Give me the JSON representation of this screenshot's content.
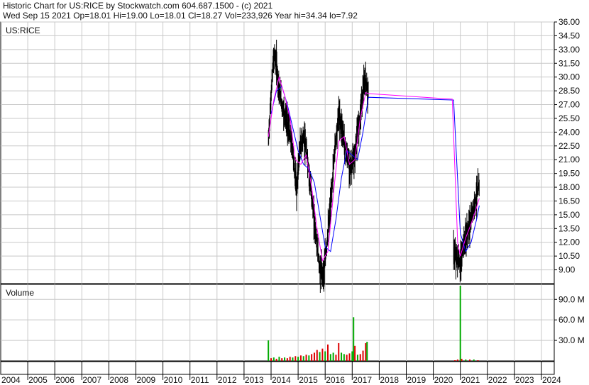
{
  "header": {
    "line1": "Historic Chart for US:RICE by Stockwatch.com 604.687.1500 - (c) 2021",
    "line2": "Wed Sep 15 2021   Op=18.01   Hi=19.00   Lo=18.01   Cl=18.27   Vol=233,926   Year hi=34.34   lo=7.92"
  },
  "price_panel": {
    "label": "US:RICE"
  },
  "volume_panel": {
    "label": "Volume"
  },
  "chart_data": {
    "type": "line",
    "ticker": "US:RICE",
    "x_labels": [
      "2004",
      "2005",
      "2006",
      "2007",
      "2008",
      "2009",
      "2010",
      "2011",
      "2012",
      "2013",
      "2014",
      "2015",
      "2016",
      "2017",
      "2018",
      "2019",
      "2020",
      "2021",
      "2022",
      "2023",
      "2024"
    ],
    "price_axis": {
      "ylim": [
        7.5,
        36.0
      ],
      "tick_labels": [
        "36.00",
        "34.50",
        "33.00",
        "31.50",
        "30.00",
        "28.50",
        "27.00",
        "25.50",
        "24.00",
        "22.50",
        "21.00",
        "19.50",
        "18.00",
        "16.50",
        "15.00",
        "13.50",
        "12.00",
        "10.50",
        "9.00"
      ]
    },
    "volume_axis": {
      "ylim": [
        0,
        110
      ],
      "tick_labels": [
        "90.0 M",
        "60.0 M",
        "30.0 M"
      ]
    },
    "price_series": {
      "x": [
        2013.9,
        2014.0,
        2014.1,
        2014.2,
        2014.3,
        2014.4,
        2014.6,
        2014.8,
        2014.95,
        2015.05,
        2015.2,
        2015.35,
        2015.5,
        2015.65,
        2015.8,
        2015.95,
        2016.05,
        2016.2,
        2016.35,
        2016.5,
        2016.65,
        2016.8,
        2016.95,
        2017.1,
        2017.25,
        2017.4,
        2017.5,
        2017.6,
        2020.75,
        2020.9,
        2021.0,
        2021.1,
        2021.25,
        2021.4,
        2021.55,
        2021.7
      ],
      "y": [
        23.0,
        28.0,
        32.5,
        31.5,
        28.5,
        27.0,
        25.0,
        22.0,
        17.5,
        22.0,
        23.5,
        21.0,
        17.0,
        13.0,
        9.0,
        8.5,
        11.5,
        16.0,
        22.0,
        26.0,
        24.0,
        21.5,
        20.0,
        21.5,
        25.0,
        28.5,
        29.5,
        28.0,
        11.0,
        10.0,
        9.5,
        11.5,
        13.0,
        14.5,
        16.5,
        18.27
      ]
    },
    "moving_average_short": {
      "color": "#ff00ff",
      "x": [
        2013.9,
        2014.1,
        2014.3,
        2014.5,
        2014.7,
        2014.9,
        2015.1,
        2015.3,
        2015.5,
        2015.7,
        2015.9,
        2016.1,
        2016.3,
        2016.5,
        2016.7,
        2016.9,
        2017.1,
        2017.3,
        2017.5,
        2017.6,
        2020.7,
        2020.9,
        2021.0,
        2021.2,
        2021.4,
        2021.6,
        2021.7
      ],
      "y": [
        23.5,
        27.5,
        30.0,
        28.0,
        25.5,
        21.0,
        20.5,
        21.5,
        18.0,
        13.5,
        10.0,
        11.0,
        17.0,
        23.0,
        23.5,
        20.5,
        21.0,
        25.5,
        28.3,
        28.2,
        27.6,
        12.0,
        10.5,
        12.5,
        14.0,
        15.8,
        16.8
      ]
    },
    "moving_average_long": {
      "color": "#0000ff",
      "x": [
        2014.0,
        2014.2,
        2014.4,
        2014.6,
        2014.8,
        2015.0,
        2015.2,
        2015.4,
        2015.6,
        2015.8,
        2016.0,
        2016.2,
        2016.4,
        2016.6,
        2016.8,
        2017.0,
        2017.2,
        2017.4,
        2017.6,
        2020.75,
        2021.0,
        2021.2,
        2021.4,
        2021.6,
        2021.7
      ],
      "y": [
        26.0,
        28.5,
        29.0,
        27.0,
        24.5,
        22.0,
        20.5,
        20.0,
        18.5,
        15.0,
        11.5,
        11.0,
        14.5,
        19.0,
        22.0,
        21.5,
        21.0,
        24.0,
        27.8,
        27.5,
        13.0,
        11.0,
        12.0,
        14.5,
        16.0
      ]
    },
    "volume_series": {
      "up_color": "#00aa00",
      "down_color": "#dd0000",
      "bars": [
        {
          "x": 2013.9,
          "v": 30,
          "c": "up"
        },
        {
          "x": 2014.0,
          "v": 4,
          "c": "down"
        },
        {
          "x": 2014.1,
          "v": 5,
          "c": "up"
        },
        {
          "x": 2014.2,
          "v": 3,
          "c": "down"
        },
        {
          "x": 2014.3,
          "v": 6,
          "c": "up"
        },
        {
          "x": 2014.4,
          "v": 4,
          "c": "down"
        },
        {
          "x": 2014.5,
          "v": 5,
          "c": "up"
        },
        {
          "x": 2014.6,
          "v": 4,
          "c": "down"
        },
        {
          "x": 2014.7,
          "v": 6,
          "c": "down"
        },
        {
          "x": 2014.8,
          "v": 5,
          "c": "up"
        },
        {
          "x": 2014.9,
          "v": 7,
          "c": "down"
        },
        {
          "x": 2015.0,
          "v": 6,
          "c": "up"
        },
        {
          "x": 2015.1,
          "v": 8,
          "c": "down"
        },
        {
          "x": 2015.2,
          "v": 7,
          "c": "up"
        },
        {
          "x": 2015.3,
          "v": 9,
          "c": "down"
        },
        {
          "x": 2015.4,
          "v": 8,
          "c": "up"
        },
        {
          "x": 2015.5,
          "v": 10,
          "c": "down"
        },
        {
          "x": 2015.6,
          "v": 12,
          "c": "down"
        },
        {
          "x": 2015.7,
          "v": 16,
          "c": "down"
        },
        {
          "x": 2015.8,
          "v": 13,
          "c": "up"
        },
        {
          "x": 2015.9,
          "v": 18,
          "c": "down"
        },
        {
          "x": 2016.0,
          "v": 14,
          "c": "up"
        },
        {
          "x": 2016.1,
          "v": 24,
          "c": "down"
        },
        {
          "x": 2016.2,
          "v": 10,
          "c": "up"
        },
        {
          "x": 2016.3,
          "v": 12,
          "c": "up"
        },
        {
          "x": 2016.4,
          "v": 9,
          "c": "down"
        },
        {
          "x": 2016.5,
          "v": 26,
          "c": "down"
        },
        {
          "x": 2016.6,
          "v": 12,
          "c": "up"
        },
        {
          "x": 2016.7,
          "v": 10,
          "c": "up"
        },
        {
          "x": 2016.8,
          "v": 9,
          "c": "down"
        },
        {
          "x": 2016.9,
          "v": 11,
          "c": "down"
        },
        {
          "x": 2017.0,
          "v": 14,
          "c": "up"
        },
        {
          "x": 2017.05,
          "v": 64,
          "c": "up"
        },
        {
          "x": 2017.1,
          "v": 22,
          "c": "down"
        },
        {
          "x": 2017.2,
          "v": 9,
          "c": "up"
        },
        {
          "x": 2017.3,
          "v": 10,
          "c": "down"
        },
        {
          "x": 2017.4,
          "v": 15,
          "c": "down"
        },
        {
          "x": 2017.5,
          "v": 26,
          "c": "down"
        },
        {
          "x": 2017.55,
          "v": 28,
          "c": "up"
        },
        {
          "x": 2020.8,
          "v": 1,
          "c": "down"
        },
        {
          "x": 2020.9,
          "v": 2,
          "c": "down"
        },
        {
          "x": 2021.0,
          "v": 110,
          "c": "up"
        },
        {
          "x": 2021.05,
          "v": 3,
          "c": "down"
        },
        {
          "x": 2021.2,
          "v": 2,
          "c": "up"
        },
        {
          "x": 2021.35,
          "v": 2,
          "c": "down"
        },
        {
          "x": 2021.5,
          "v": 2,
          "c": "up"
        },
        {
          "x": 2021.65,
          "v": 1,
          "c": "down"
        }
      ]
    },
    "grid": true
  }
}
